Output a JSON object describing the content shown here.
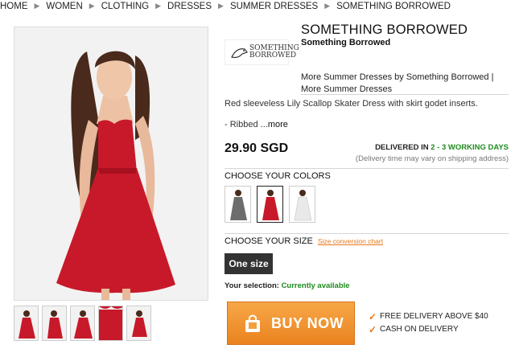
{
  "breadcrumb": [
    "HOME",
    "WOMEN",
    "CLOTHING",
    "DRESSES",
    "SUMMER DRESSES",
    "SOMETHING BORROWED"
  ],
  "product": {
    "title": "SOMETHING BORROWED",
    "brand": "Something Borrowed",
    "logo_text_line1": "SOMETHING",
    "logo_text_line2": "BORROWED",
    "more_links_line1": "More Summer Dresses by Something Borrowed  |",
    "more_links_line2": "More Summer Dresses",
    "description": "Red sleeveless Lily Scallop Skater Dress with skirt godet inserts.",
    "ribbed": "- Ribbed ...",
    "more_label": "more",
    "price": "29.90 SGD"
  },
  "delivery": {
    "prefix": "DELIVERED IN ",
    "days": "2 - 3 WORKING DAYS",
    "note": "(Delivery time may vary on shipping address)"
  },
  "colors": {
    "label": "CHOOSE YOUR COLORS",
    "swatches": [
      {
        "name": "grey",
        "color": "#6d6d6d",
        "selected": false
      },
      {
        "name": "red",
        "color": "#c8192a",
        "selected": true
      },
      {
        "name": "white",
        "color": "#e9e9e9",
        "selected": false
      }
    ]
  },
  "size": {
    "label": "CHOOSE YOUR SIZE",
    "chart_link": "Size conversion chart",
    "selected": "One size"
  },
  "selection": {
    "label": "Your selection: ",
    "status": "Currently available"
  },
  "buy": {
    "label": "BUY NOW"
  },
  "perks": [
    "FREE DELIVERY ABOVE $40",
    "CASH ON DELIVERY"
  ],
  "theme": {
    "accent": "#e6791c",
    "success": "#1e8a1e",
    "dress_red": "#c8192a"
  }
}
